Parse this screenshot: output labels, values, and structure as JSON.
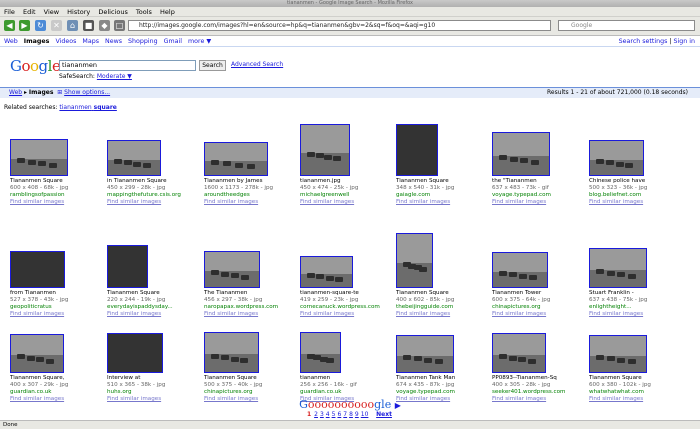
{
  "window": {
    "title": "tiananmen - Google Image Search - Mozilla Firefox"
  },
  "menu": [
    "File",
    "Edit",
    "View",
    "History",
    "Delicious",
    "Tools",
    "Help"
  ],
  "toolbar": {
    "url": "http://images.google.com/images?hl=en&source=hp&q=tiananmen&gbv=2&sq=f&oq=&aqi=g10",
    "search_placeholder": "Google"
  },
  "gnav": {
    "items": [
      "Web",
      "Images",
      "Videos",
      "Maps",
      "News",
      "Shopping",
      "Gmail",
      "more ▼"
    ],
    "settings": "Search settings",
    "signin": "Sign in"
  },
  "search": {
    "logo": "Google",
    "query": "tiananmen",
    "button": "Search",
    "advanced": "Advanced Search",
    "safesearch_label": "SafeSearch:",
    "safesearch_value": "Moderate ▼"
  },
  "results_bar": {
    "crumb_web": "Web",
    "crumb_images": "Images",
    "options": "Show options...",
    "summary": "Results 1 - 21 of about 721,000 (0.18 seconds)"
  },
  "related": {
    "label": "Related searches:",
    "link_a": "tiananmen",
    "link_b": "square"
  },
  "results": [
    {
      "cap": "Tiananmen Square",
      "meta": "600 x 408 - 68k - jpg",
      "site": "ramblingsofpassion"
    },
    {
      "cap": "in Tiananmen Square",
      "meta": "450 x 299 - 28k - jpg",
      "site": "mappingthefuture.csis.org"
    },
    {
      "cap": "Tiananmen by James",
      "meta": "1600 x 1173 - 278k - jpg",
      "site": "aroundtheedges"
    },
    {
      "cap": "tiananmen.jpg",
      "meta": "450 x 474 - 25k - jpg",
      "site": "michaelgreenwell"
    },
    {
      "cap": "Tiananmen Square",
      "meta": "348 x 540 - 31k - jpg",
      "site": "gaiagle.com"
    },
    {
      "cap": "the \"Tiananmen",
      "meta": "637 x 483 - 73k - gif",
      "site": "voyage.typepad.com"
    },
    {
      "cap": "Chinese police have",
      "meta": "500 x 323 - 36k - jpg",
      "site": "blog.beliefnet.com"
    },
    {
      "cap": "from Tiananmen",
      "meta": "527 x 378 - 43k - jpg",
      "site": "geopoliticratus"
    },
    {
      "cap": "Tiananmen Square",
      "meta": "220 x 244 - 19k - jpg",
      "site": "everydayispaddysday..."
    },
    {
      "cap": "The Tiananmen",
      "meta": "456 x 297 - 38k - jpg",
      "site": "naropapax.wordpress.com"
    },
    {
      "cap": "tiananmen-square-te",
      "meta": "419 x 259 - 23k - jpg",
      "site": "cornecanuck.wordpress.com"
    },
    {
      "cap": "Tiananmen Square",
      "meta": "400 x 602 - 85k - jpg",
      "site": "thebeijingguide.com"
    },
    {
      "cap": "Tiananmen Tower",
      "meta": "600 x 375 - 64k - jpg",
      "site": "chinapictures.org"
    },
    {
      "cap": "Stuart Franklin -",
      "meta": "637 x 438 - 75k - jpg",
      "site": "enlightheight..."
    },
    {
      "cap": "Tiananmen Square,",
      "meta": "400 x 307 - 29k - jpg",
      "site": "guardian.co.uk"
    },
    {
      "cap": "Interview at",
      "meta": "510 x 365 - 38k - jpg",
      "site": "huhs.org"
    },
    {
      "cap": "Tiananmen Square",
      "meta": "500 x 375 - 40k - jpg",
      "site": "chinapictures.org"
    },
    {
      "cap": "tiananmen",
      "meta": "256 x 256 - 16k - gif",
      "site": "guardian.co.uk"
    },
    {
      "cap": "Tiananmen Tank Man",
      "meta": "674 x 435 - 87k - jpg",
      "site": "voyage.typepad.com"
    },
    {
      "cap": "PP0893--Tiananmen-Sq",
      "meta": "400 x 305 - 28k - jpg",
      "site": "seeker401.wordpress.com"
    },
    {
      "cap": "Tiananmen Square",
      "meta": "600 x 380 - 102k - jpg",
      "site": "whatwhatwhat.com"
    }
  ],
  "similar_label": "Find similar images",
  "pager": {
    "logo_g": "G",
    "logo_o": "oooooooooo",
    "logo_gle": "gle",
    "arrow": "▶",
    "pages": [
      "1",
      "2",
      "3",
      "4",
      "5",
      "6",
      "7",
      "8",
      "9",
      "10"
    ],
    "next": "Next"
  },
  "status": "Done"
}
